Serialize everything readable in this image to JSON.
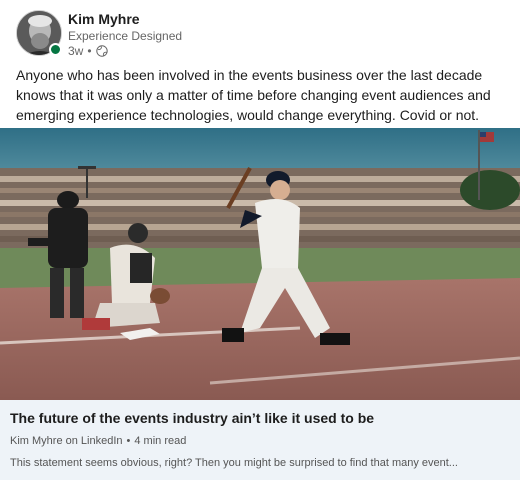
{
  "post": {
    "author": {
      "name": "Kim Myhre",
      "headline": "Experience Designed",
      "time": "3w",
      "visibility_icon": "globe-icon",
      "online_status_color": "#057642"
    },
    "text": "Anyone who has been involved in the events business over the last decade knows that it was only a matter of time before changing event audiences and emerging experience technologies, would change everything. Covid or not."
  },
  "link_preview": {
    "title": "The future of the events industry ain’t like it used to be",
    "source": "Kim Myhre on LinkedIn",
    "read_time": "4 min read",
    "description": "This statement seems obvious, right?  Then you might be surprised to find that many event..."
  },
  "colors": {
    "card_background": "#eef3f8",
    "secondary_text": "#666666"
  }
}
